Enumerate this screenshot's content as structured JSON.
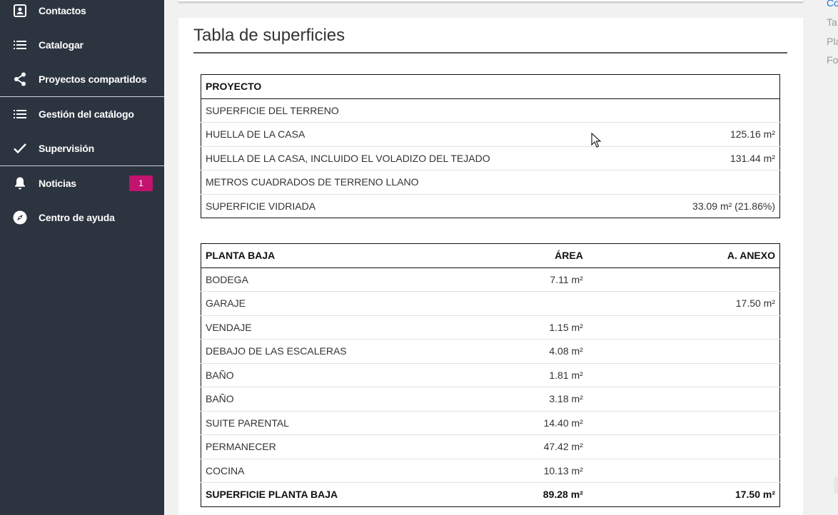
{
  "sidebar": {
    "items": [
      {
        "label": "Contactos",
        "icon": "contact-card-icon"
      },
      {
        "label": "Catalogar",
        "icon": "list-icon"
      },
      {
        "label": "Proyectos compartidos",
        "icon": "share-icon"
      },
      {
        "label": "Gestión del catálogo",
        "icon": "list-icon"
      },
      {
        "label": "Supervisión",
        "icon": "check-icon"
      },
      {
        "label": "Noticias",
        "icon": "bell-icon",
        "badge": "1"
      },
      {
        "label": "Centro de ayuda",
        "icon": "compass-icon"
      }
    ],
    "badge_color": "#c2136f",
    "background_color": "#2c3440"
  },
  "main": {
    "title": "Tabla de superficies",
    "proyecto": {
      "header": "PROYECTO",
      "rows": [
        {
          "label": "SUPERFICIE DEL TERRENO",
          "value": ""
        },
        {
          "label": "HUELLA DE LA CASA",
          "value": "125.16 m²"
        },
        {
          "label": "HUELLA DE LA CASA, INCLUIDO EL VOLADIZO DEL TEJADO",
          "value": "131.44 m²"
        },
        {
          "label": "METROS CUADRADOS DE TERRENO LLANO",
          "value": ""
        },
        {
          "label": "SUPERFICIE VIDRIADA",
          "value": "33.09 m² (21.86%)"
        }
      ]
    },
    "planta_baja": {
      "headers": [
        "PLANTA BAJA",
        "ÁREA",
        "A. ANEXO"
      ],
      "rows": [
        {
          "label": "BODEGA",
          "area": "7.11 m²",
          "anexo": ""
        },
        {
          "label": "GARAJE",
          "area": "",
          "anexo": "17.50 m²"
        },
        {
          "label": "VENDAJE",
          "area": "1.15 m²",
          "anexo": ""
        },
        {
          "label": "DEBAJO DE LAS ESCALERAS",
          "area": "4.08 m²",
          "anexo": ""
        },
        {
          "label": "BAÑO",
          "area": "1.81 m²",
          "anexo": ""
        },
        {
          "label": "BAÑO",
          "area": "3.18 m²",
          "anexo": ""
        },
        {
          "label": "SUITE PARENTAL",
          "area": "14.40 m²",
          "anexo": ""
        },
        {
          "label": "PERMANECER",
          "area": "47.42 m²",
          "anexo": ""
        },
        {
          "label": "COCINA",
          "area": "10.13 m²",
          "anexo": ""
        }
      ],
      "total": {
        "label": "SUPERFICIE PLANTA BAJA",
        "area": "89.28 m²",
        "anexo": "17.50 m²"
      }
    }
  },
  "toc": {
    "items": [
      "Co",
      "Ta",
      "Pla",
      "Fo"
    ],
    "accent_color": "#1976d2"
  }
}
